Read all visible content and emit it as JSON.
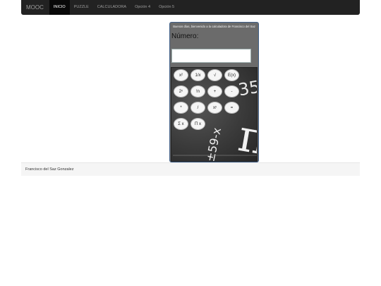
{
  "nav": {
    "brand": "MOOC",
    "items": [
      "INICIO",
      "PUZZLE",
      "CALCULADORA",
      "Opción 4",
      "Opción 5"
    ]
  },
  "calculator": {
    "greeting": "Buenos días, bienvenido a la calculadora de Francisco del Saz",
    "number_label": "Número:",
    "number_value": "",
    "buttons": [
      "x²",
      "1/x",
      "√",
      "E(x)",
      "2ⁿ",
      "!n",
      "+",
      "-",
      "*",
      "/",
      "xʸ",
      "=",
      "Σ x",
      "Π x"
    ],
    "chalk_text": [
      "35",
      "π",
      "±59-x"
    ]
  },
  "footer": {
    "text": "Francisco del Saz Gonzalez"
  }
}
